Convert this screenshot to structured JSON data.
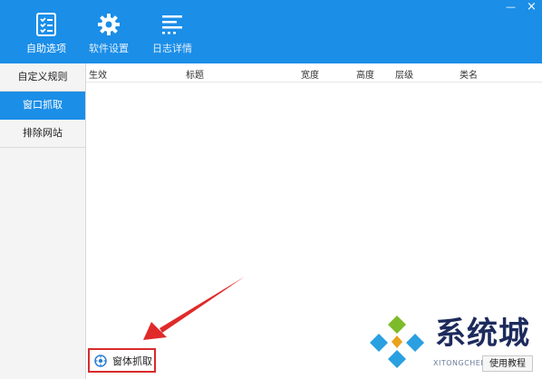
{
  "window": {
    "minimize": "—",
    "close": "×"
  },
  "toolbar": [
    {
      "label": "自助选项",
      "icon": "checklist-icon"
    },
    {
      "label": "软件设置",
      "icon": "gear-icon"
    },
    {
      "label": "日志详情",
      "icon": "log-lines-icon"
    }
  ],
  "sidebar": {
    "items": [
      {
        "label": "自定义规则"
      },
      {
        "label": "窗口抓取",
        "active": true
      },
      {
        "label": "排除网站"
      }
    ]
  },
  "table": {
    "columns": [
      "生效",
      "标题",
      "宽度",
      "高度",
      "层级",
      "类名"
    ],
    "rows": []
  },
  "capture_button": {
    "label": "窗体抓取",
    "icon": "target-icon"
  },
  "help_button": {
    "label": "使用教程"
  },
  "watermark": {
    "brand": "系统城",
    "url": "XITONGCHENG.COM"
  },
  "colors": {
    "accent": "#1b8ee8",
    "highlight": "#d92b2b"
  }
}
